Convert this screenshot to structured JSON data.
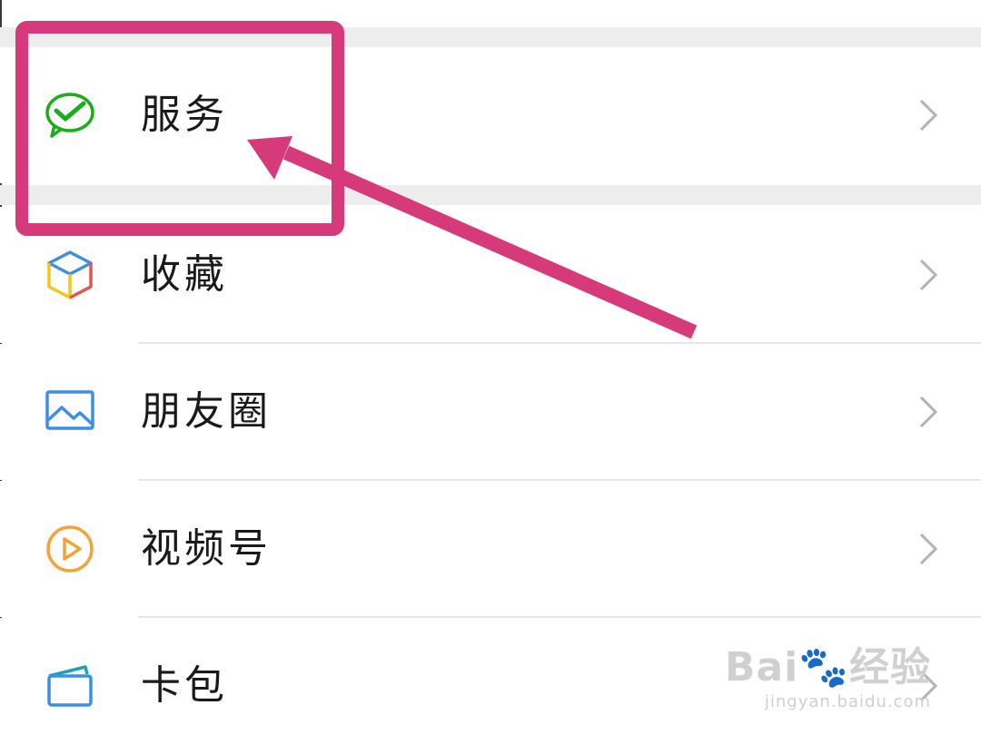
{
  "menu": {
    "items": [
      {
        "label": "服务",
        "icon": "wechat-pay-icon"
      },
      {
        "label": "收藏",
        "icon": "favorites-cube-icon"
      },
      {
        "label": "朋友圈",
        "icon": "moments-photo-icon"
      },
      {
        "label": "视频号",
        "icon": "channels-play-icon"
      },
      {
        "label": "卡包",
        "icon": "card-wallet-icon"
      }
    ]
  },
  "annotation": {
    "color": "#d63a7a"
  },
  "watermark": {
    "brand": "Bai🐾经验",
    "url": "jingyan.baidu.com"
  },
  "colors": {
    "background": "#ffffff",
    "separator_band": "#ededed",
    "divider": "#e6e6e6",
    "text": "#1a1a1a",
    "chevron": "#b3b3b3",
    "wechat_green": "#1aad19"
  }
}
